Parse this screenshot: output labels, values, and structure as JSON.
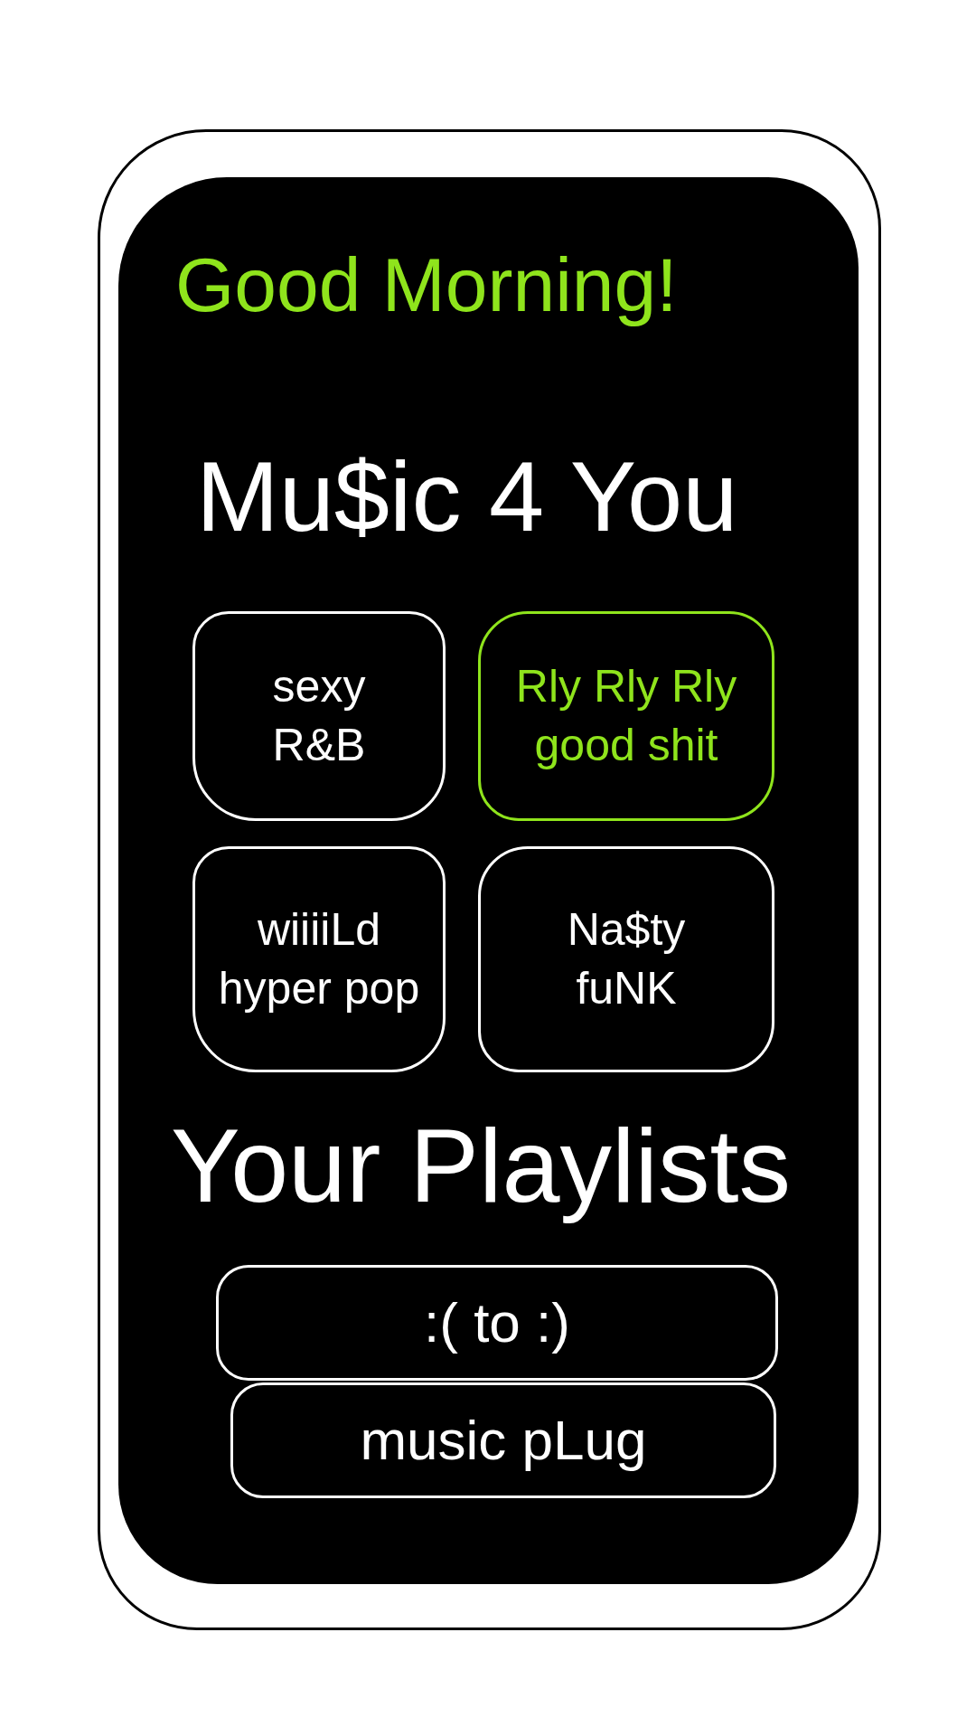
{
  "greeting": "Good Morning!",
  "recommendations": {
    "title": "Mu$ic 4 You",
    "tiles": [
      {
        "label": "sexy\nR&B",
        "selected": false
      },
      {
        "label": "Rly Rly Rly\ngood shit",
        "selected": true
      },
      {
        "label": "wiiiiLd\nhyper pop",
        "selected": false
      },
      {
        "label": "Na$ty\nfuNK",
        "selected": false
      }
    ]
  },
  "playlists": {
    "title": "Your Playlists",
    "items": [
      ":( to :)",
      "music pLug"
    ]
  }
}
